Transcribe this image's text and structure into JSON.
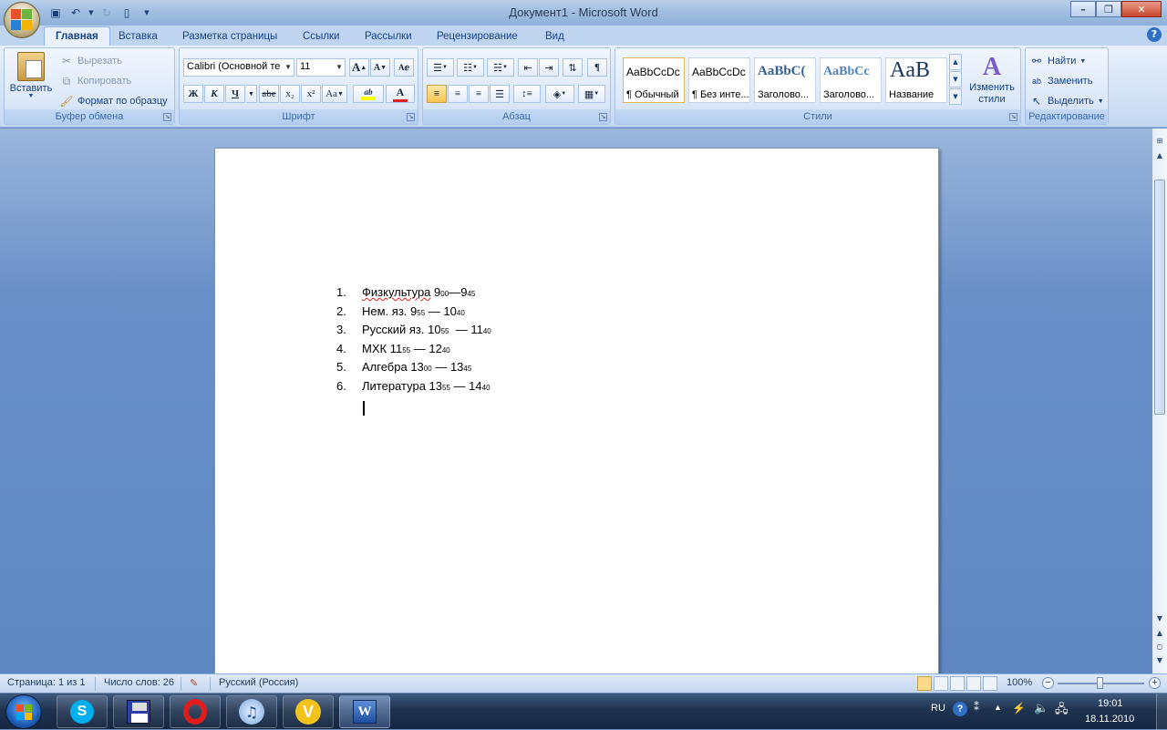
{
  "window": {
    "title": "Документ1 - Microsoft Word",
    "controls": {
      "minimize": "–",
      "restore": "❐",
      "close": "✕"
    }
  },
  "quick_access": {
    "save_icon": "save-icon",
    "undo_icon": "undo-icon",
    "redo_icon": "redo-icon",
    "new_icon": "new-doc-icon"
  },
  "tabs": [
    {
      "label": "Главная",
      "active": true
    },
    {
      "label": "Вставка"
    },
    {
      "label": "Разметка страницы"
    },
    {
      "label": "Ссылки"
    },
    {
      "label": "Рассылки"
    },
    {
      "label": "Рецензирование"
    },
    {
      "label": "Вид"
    }
  ],
  "help_label": "?",
  "clipboard": {
    "group_label": "Буфер обмена",
    "paste_label": "Вставить",
    "cut_label": "Вырезать",
    "copy_label": "Копировать",
    "format_painter_label": "Формат по образцу"
  },
  "font": {
    "group_label": "Шрифт",
    "font_name": "Calibri (Основной те",
    "font_size": "11",
    "bold": "Ж",
    "italic": "К",
    "underline": "Ч",
    "strike": "abe",
    "subscript": "x₂",
    "superscript": "x²",
    "change_case": "Aa",
    "grow": "A",
    "shrink": "A",
    "font_color_letter": "A",
    "highlight_letter": "ab",
    "font_color": "#e02020",
    "highlight_color": "#ffff00"
  },
  "paragraph": {
    "group_label": "Абзац",
    "pilcrow": "¶"
  },
  "styles": {
    "group_label": "Стили",
    "tiles": [
      {
        "sample": "AaBbCcDc",
        "name": "¶ Обычный"
      },
      {
        "sample": "AaBbCcDc",
        "name": "¶ Без инте..."
      },
      {
        "sample": "AaBbC(",
        "name": "Заголово..."
      },
      {
        "sample": "AaBbCc",
        "name": "Заголово..."
      },
      {
        "sample": "AaB",
        "name": "Название"
      }
    ],
    "change_styles_label": "Изменить стили"
  },
  "editing": {
    "group_label": "Редактирование",
    "find_label": "Найти",
    "replace_label": "Заменить",
    "select_label": "Выделить"
  },
  "document": {
    "items": [
      {
        "num": "1.",
        "text": "Физкультура",
        "time": [
          "9",
          "00",
          "—",
          "9",
          "45"
        ]
      },
      {
        "num": "2.",
        "text": "Нем. яз.",
        "time": [
          "9",
          "55",
          " — ",
          "10",
          "40"
        ]
      },
      {
        "num": "3.",
        "text": "Русский яз.",
        "time": [
          "10",
          "55",
          "  — ",
          "11",
          "40"
        ]
      },
      {
        "num": "4.",
        "text": "МХК",
        "time": [
          "11",
          "55",
          " — ",
          "12",
          "40"
        ]
      },
      {
        "num": "5.",
        "text": "Алгебра",
        "time": [
          "13",
          "00",
          " — ",
          "13",
          "45"
        ]
      },
      {
        "num": "6.",
        "text": "Литература",
        "time": [
          "13",
          "55",
          " — ",
          "14",
          "40"
        ]
      }
    ]
  },
  "status": {
    "page": "Страница: 1 из 1",
    "words": "Число слов: 26",
    "language": "Русский (Россия)",
    "zoom": "100%",
    "zoom_minus": "−",
    "zoom_plus": "+",
    "zoom_level": 1.0
  },
  "taskbar": {
    "apps": [
      "skype-icon",
      "save-icon",
      "opera-icon",
      "itunes-icon",
      "vlc-icon",
      "word-icon"
    ],
    "lang": "RU",
    "time": "19:01",
    "date": "18.11.2010"
  }
}
